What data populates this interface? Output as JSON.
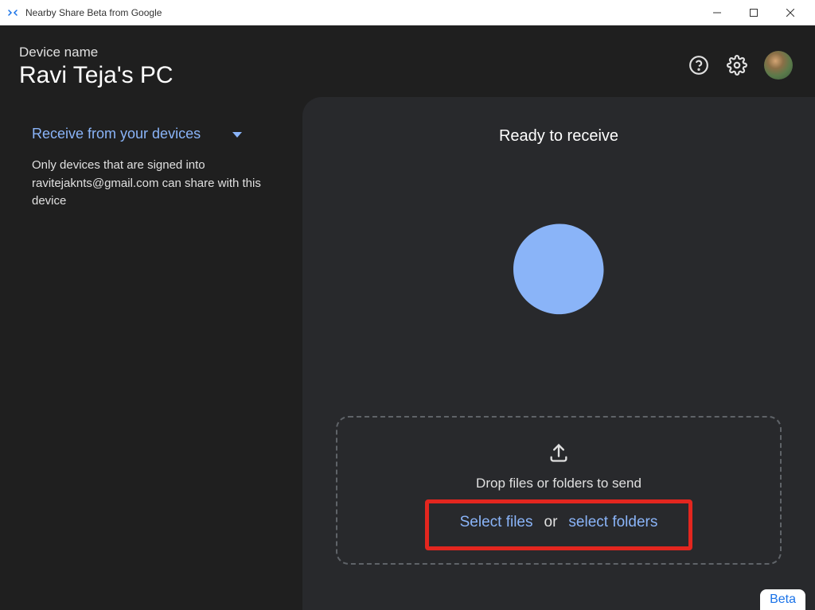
{
  "titlebar": {
    "title": "Nearby Share Beta from Google"
  },
  "header": {
    "device_label": "Device name",
    "device_name": "Ravi Teja's PC"
  },
  "sidebar": {
    "receive_label": "Receive from your devices",
    "receive_description": "Only devices that are signed into ravitejaknts@gmail.com can share with this device"
  },
  "main": {
    "ready_title": "Ready to receive",
    "drop_text": "Drop files or folders to send",
    "select_files": "Select files",
    "or_text": "or",
    "select_folders": "select folders"
  },
  "footer": {
    "beta_label": "Beta"
  }
}
